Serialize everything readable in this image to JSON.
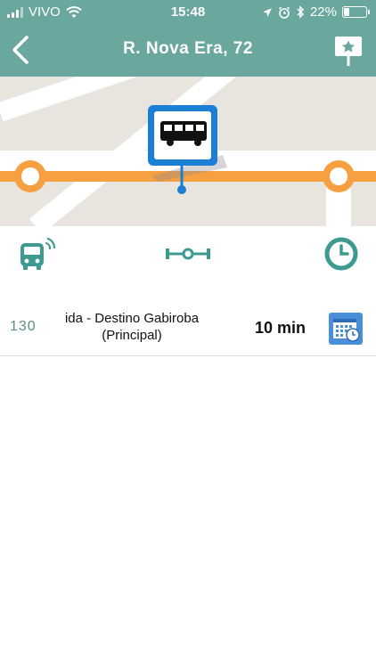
{
  "status_bar": {
    "carrier": "VIVO",
    "time": "15:48",
    "battery": "22%",
    "icons": [
      "signal-icon",
      "wifi-icon",
      "location-arrow-icon",
      "alarm-icon",
      "bluetooth-icon",
      "battery-icon"
    ]
  },
  "header": {
    "title": "R. Nova Era, 72",
    "back_icon": "chevron-left-icon",
    "favorite_icon": "bookmark-star-icon"
  },
  "map": {
    "stop_icon": "bus-stop-icon",
    "line_color": "#f7a042",
    "stop_color": "#1b7fd6"
  },
  "icon_bar": {
    "icons": [
      "bus-realtime-icon",
      "distance-icon",
      "clock-icon"
    ],
    "color": "#3d9a90"
  },
  "routes": [
    {
      "number": "130",
      "destination_line1": "ida - Destino Gabiroba",
      "destination_line2": "(Principal)",
      "eta": "10 min",
      "schedule_icon": "calendar-clock-icon"
    }
  ],
  "colors": {
    "header": "#6aa79e",
    "accent": "#3d9a90",
    "calendar": "#4a90d9"
  }
}
